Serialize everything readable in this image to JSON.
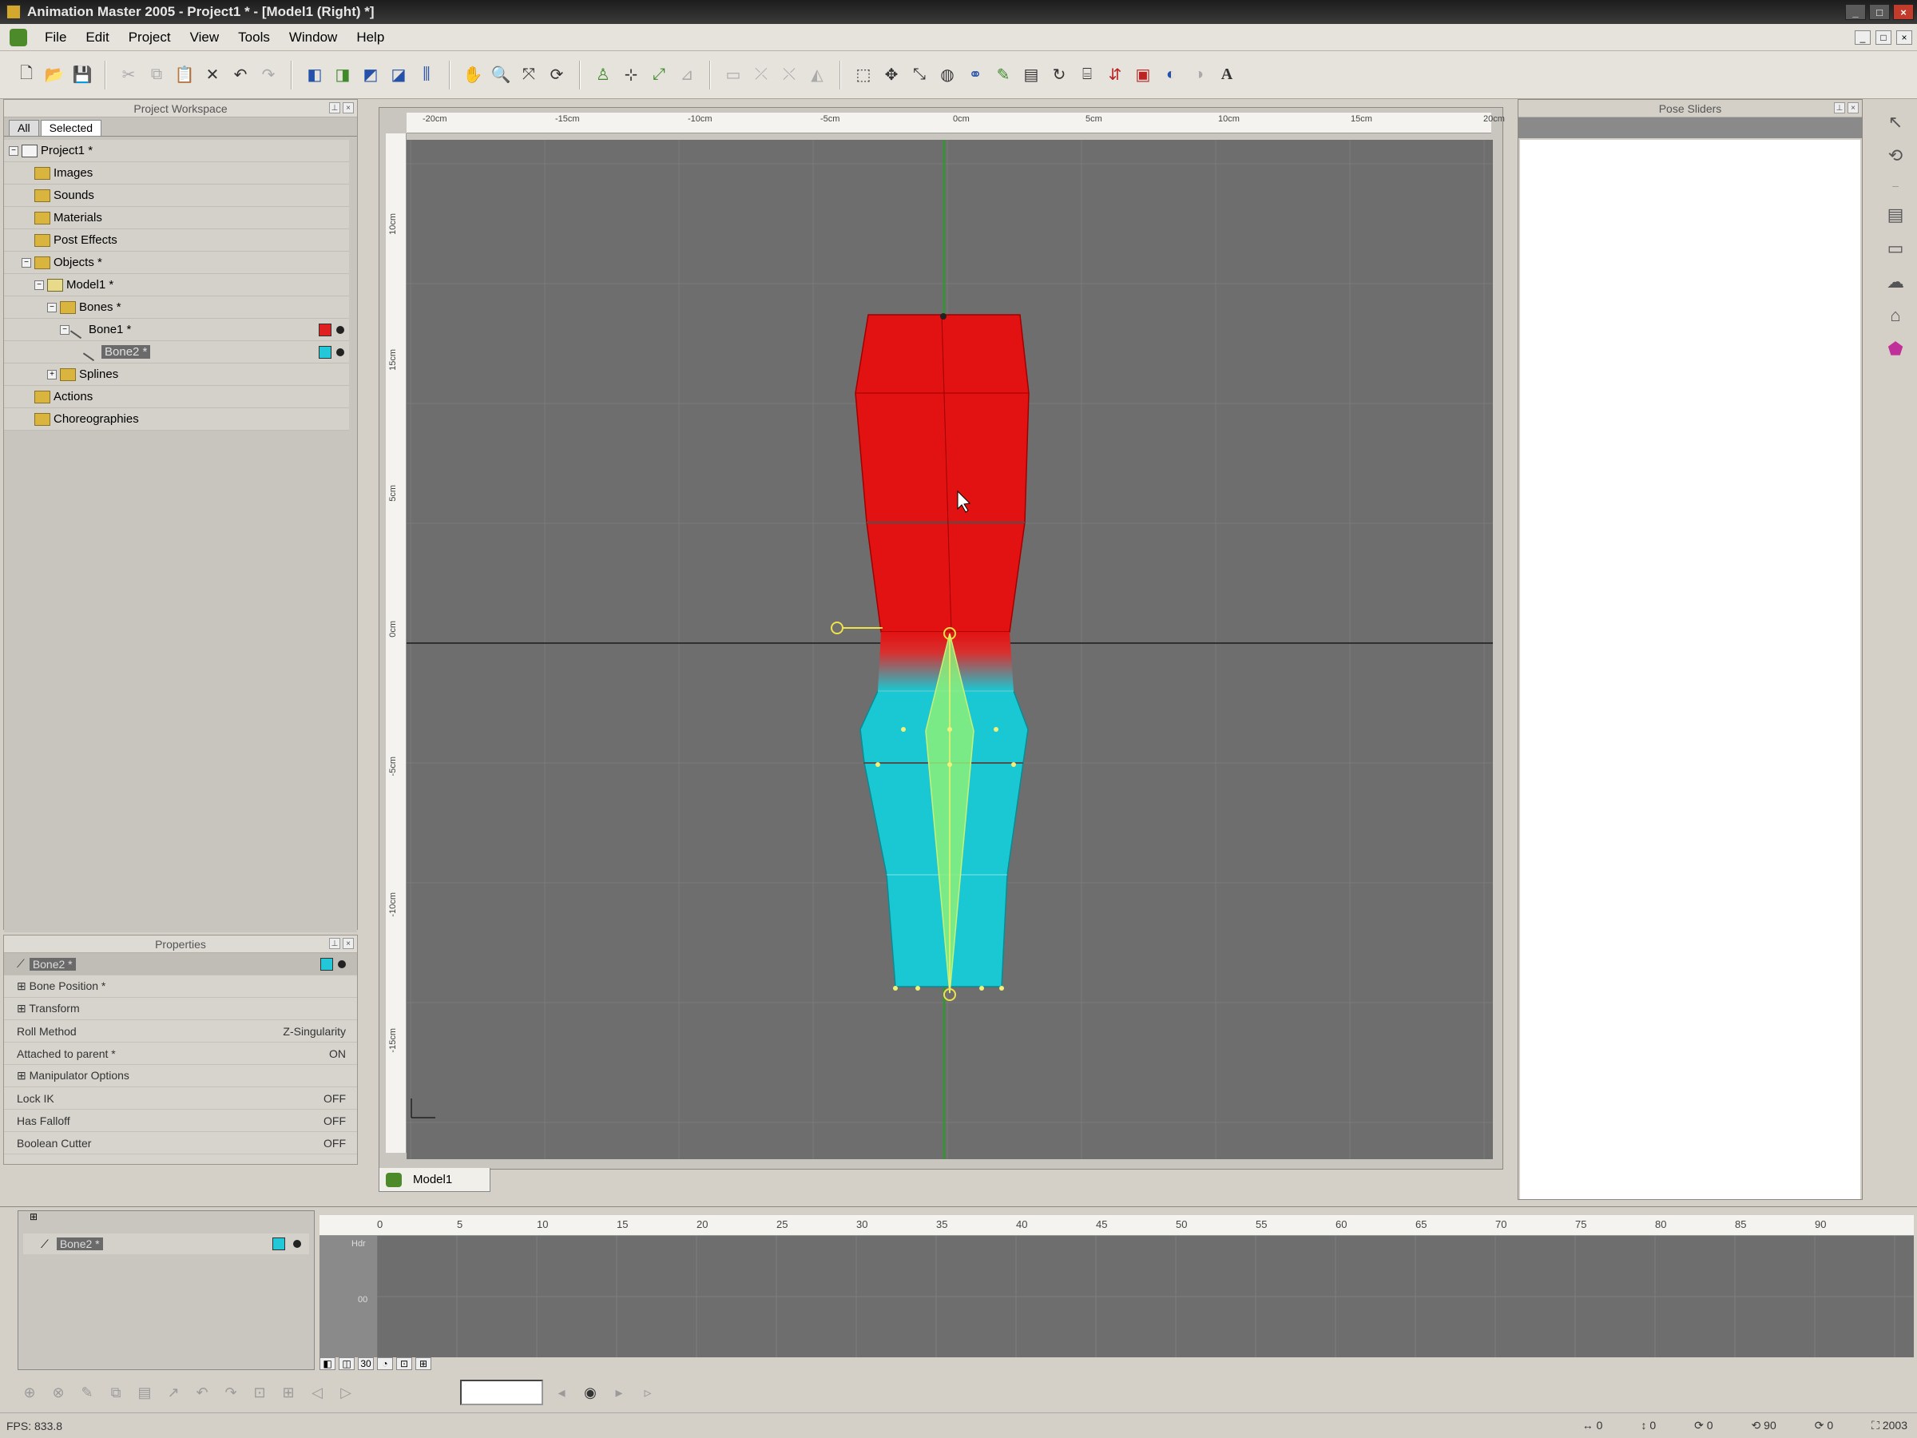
{
  "window": {
    "title": "Animation Master 2005 - Project1 * - [Model1 (Right) *]",
    "buttons": [
      "_",
      "□",
      "×"
    ]
  },
  "menu": {
    "items": [
      "File",
      "Edit",
      "Project",
      "View",
      "Tools",
      "Window",
      "Help"
    ],
    "mdi_buttons": [
      "_",
      "□",
      "×"
    ]
  },
  "toolbar": {
    "groups": [
      [
        "new-icon",
        "open-icon",
        "save-icon"
      ],
      [
        "cut-icon",
        "copy-icon",
        "paste-icon",
        "delete-icon",
        "undo-icon",
        "redo-icon"
      ],
      [
        "view-icon-1",
        "view-icon-2",
        "view-icon-3",
        "view-icon-4",
        "view-icon-5"
      ],
      [
        "hand-icon",
        "zoom-icon",
        "zoom-fit-icon",
        "rotate-icon"
      ],
      [
        "bone-icon",
        "skeletal-icon",
        "mode-icon-3",
        "mode-icon-4"
      ],
      [
        "mode-icon-5",
        "mode-icon-6",
        "mode-icon-7",
        "mode-icon-8"
      ],
      [
        "select-icon",
        "move-icon",
        "scale-icon",
        "rotate2-icon",
        "binoculars-icon",
        "pen-icon",
        "doc-icon",
        "lathe-icon",
        "extrude-icon",
        "flip-icon",
        "render-icon",
        "sphere-icon",
        "half-icon",
        "text-icon"
      ]
    ]
  },
  "workspace": {
    "title": "Project Workspace",
    "tabs": [
      "All",
      "Selected"
    ],
    "tree": [
      {
        "label": "Project1 *",
        "indent": 0,
        "icon": "proj",
        "expander": "−"
      },
      {
        "label": "Images",
        "indent": 1,
        "icon": "folder"
      },
      {
        "label": "Sounds",
        "indent": 1,
        "icon": "folder"
      },
      {
        "label": "Materials",
        "indent": 1,
        "icon": "folder"
      },
      {
        "label": "Post Effects",
        "indent": 1,
        "icon": "folder"
      },
      {
        "label": "Objects *",
        "indent": 1,
        "icon": "folder",
        "expander": "−"
      },
      {
        "label": "Model1 *",
        "indent": 2,
        "icon": "model",
        "expander": "−"
      },
      {
        "label": "Bones *",
        "indent": 3,
        "icon": "folder",
        "expander": "−"
      },
      {
        "label": "Bone1 *",
        "indent": 4,
        "icon": "bone",
        "expander": "−",
        "swatch": "#e02020"
      },
      {
        "label": "Bone2 *",
        "indent": 5,
        "icon": "bone",
        "selected": true,
        "swatch": "#22c8d8"
      },
      {
        "label": "Splines",
        "indent": 3,
        "icon": "folder",
        "expander": "+"
      },
      {
        "label": "Actions",
        "indent": 1,
        "icon": "folder"
      },
      {
        "label": "Choreographies",
        "indent": 1,
        "icon": "folder"
      }
    ]
  },
  "properties": {
    "title": "Properties",
    "header": "Bone2 *",
    "rows": [
      {
        "name": "Bone Position *",
        "value": ""
      },
      {
        "name": "Transform",
        "value": ""
      },
      {
        "name": "Roll Method",
        "value": "Z-Singularity"
      },
      {
        "name": "Attached to parent *",
        "value": "ON"
      },
      {
        "name": "Manipulator Options",
        "value": ""
      },
      {
        "name": "Lock IK",
        "value": "OFF"
      },
      {
        "name": "Has Falloff",
        "value": "OFF"
      },
      {
        "name": "Boolean Cutter",
        "value": "OFF"
      }
    ]
  },
  "viewport": {
    "tab_label": "Model1",
    "ruler_top": [
      "-20cm",
      "-15cm",
      "-10cm",
      "-5cm",
      "0cm",
      "5cm",
      "10cm",
      "15cm",
      "20cm"
    ],
    "ruler_left": [
      "10cm",
      "15cm",
      "5cm",
      "0cm",
      "-5cm",
      "-10cm",
      "-15cm"
    ],
    "colors": {
      "background": "#6e6e6e",
      "upper_mesh": "#e31212",
      "lower_mesh": "#19c8d2",
      "bone": "#8cf07a",
      "axis_green": "#1fa31f"
    }
  },
  "pose": {
    "title": "Pose Sliders"
  },
  "right_tools": [
    "arrow-icon",
    "lasso-icon",
    "dash",
    "doc-icon",
    "frame-icon",
    "cloud-icon",
    "cloud2-icon",
    "magenta-icon"
  ],
  "timeline": {
    "row_label": "Bone2 *",
    "frames": [
      "0",
      "5",
      "10",
      "15",
      "20",
      "25",
      "30",
      "35",
      "40",
      "45",
      "50",
      "55",
      "60",
      "65",
      "70",
      "75",
      "80",
      "85",
      "90"
    ],
    "key_labels": [
      "Hdr",
      "00"
    ],
    "bottom_buttons": [
      "◧",
      "◫",
      "30",
      "◔",
      "⊡",
      "⊞"
    ]
  },
  "playbar": {
    "buttons": [
      "⊕",
      "⊗",
      "✎",
      "⧉",
      "▤",
      "↗",
      "↶",
      "↷",
      "⊡",
      "⊞",
      "◁",
      "▷"
    ]
  },
  "status": {
    "fps": "FPS: 833.8",
    "right": [
      "↔ 0",
      "↕ 0",
      "⟳ 0",
      "⟲ 90",
      "⟳ 0",
      "⛶ 2003"
    ]
  }
}
